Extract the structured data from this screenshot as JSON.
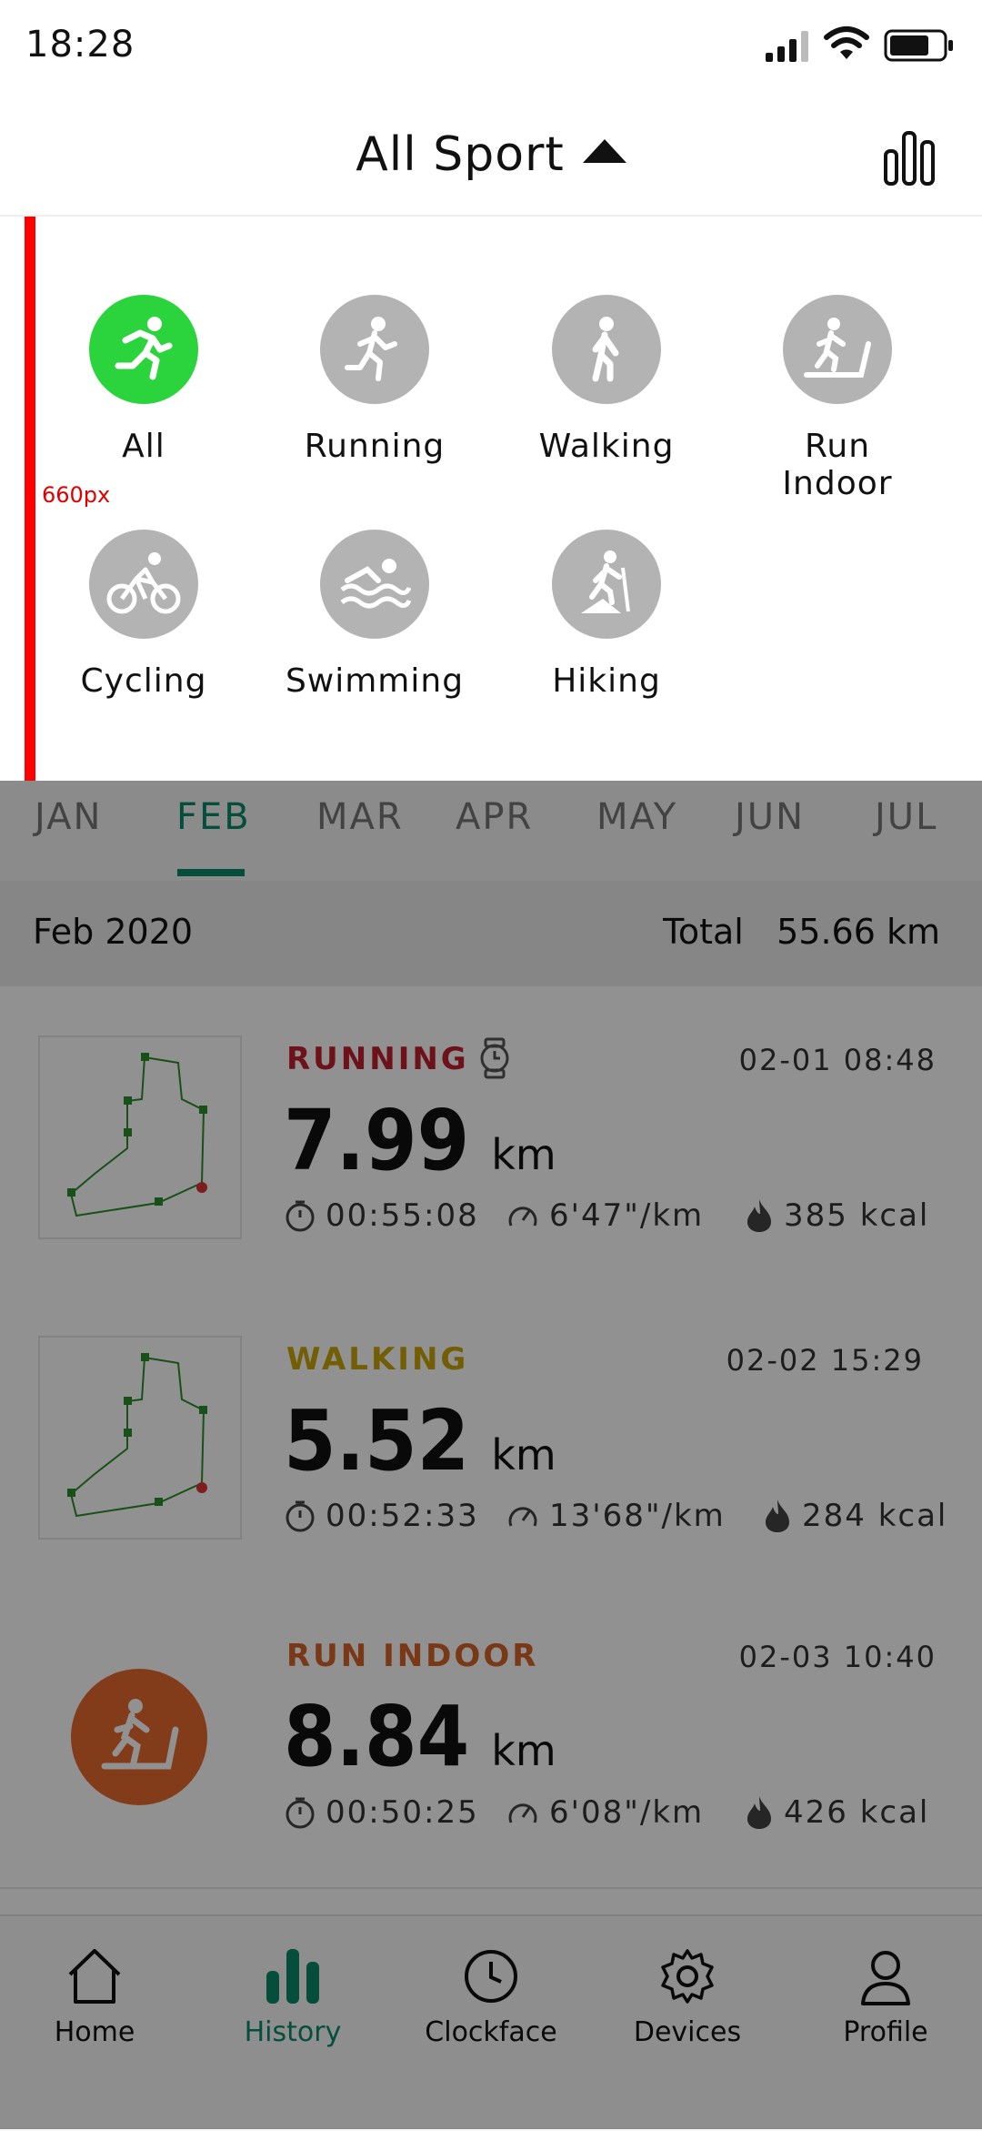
{
  "status_bar": {
    "time": "18:28"
  },
  "header": {
    "title": "All Sport"
  },
  "dropdown": {
    "marker_label": "660px",
    "sports": [
      {
        "label": "All",
        "icon": "run-icon",
        "active": true
      },
      {
        "label": "Running",
        "icon": "run-icon",
        "active": false
      },
      {
        "label": "Walking",
        "icon": "walk-icon",
        "active": false
      },
      {
        "label": "Run Indoor",
        "icon": "treadmill-icon",
        "active": false
      },
      {
        "label": "Cycling",
        "icon": "bike-icon",
        "active": false
      },
      {
        "label": "Swimming",
        "icon": "swim-icon",
        "active": false
      },
      {
        "label": "Hiking",
        "icon": "hike-icon",
        "active": false
      }
    ],
    "active_color": "#2bd43c"
  },
  "months": [
    "JAN",
    "FEB",
    "MAR",
    "APR",
    "MAY",
    "JUN",
    "JUL"
  ],
  "selected_month": "FEB",
  "summary": {
    "month": "Feb 2020",
    "total_label": "Total",
    "total_value": "55.66 km"
  },
  "activities": [
    {
      "type": "RUNNING",
      "type_color": "#c0212f",
      "date": "02-01 08:48",
      "distance": "7.99",
      "unit": "km",
      "duration": "00:55:08",
      "pace": "6'47\"/km",
      "calories": "385 kcal",
      "thumb": "map"
    },
    {
      "type": "WALKING",
      "type_color": "#c9a50a",
      "date": "02-02 15:29",
      "distance": "5.52",
      "unit": "km",
      "duration": "00:52:33",
      "pace": "13'68\"/km",
      "calories": "284 kcal",
      "thumb": "map"
    },
    {
      "type": "RUN INDOOR",
      "type_color": "#d5642a",
      "date": "02-03 10:40",
      "distance": "8.84",
      "unit": "km",
      "duration": "00:50:25",
      "pace": "6'08\"/km",
      "calories": "426 kcal",
      "thumb": "treadmill-icon"
    }
  ],
  "tabs": [
    {
      "label": "Home",
      "icon": "home-icon"
    },
    {
      "label": "History",
      "icon": "bar-chart-icon",
      "active": true
    },
    {
      "label": "Clockface",
      "icon": "clock-icon"
    },
    {
      "label": "Devices",
      "icon": "gear-icon"
    },
    {
      "label": "Profile",
      "icon": "user-icon"
    }
  ],
  "accent_color": "#0b8a6a"
}
